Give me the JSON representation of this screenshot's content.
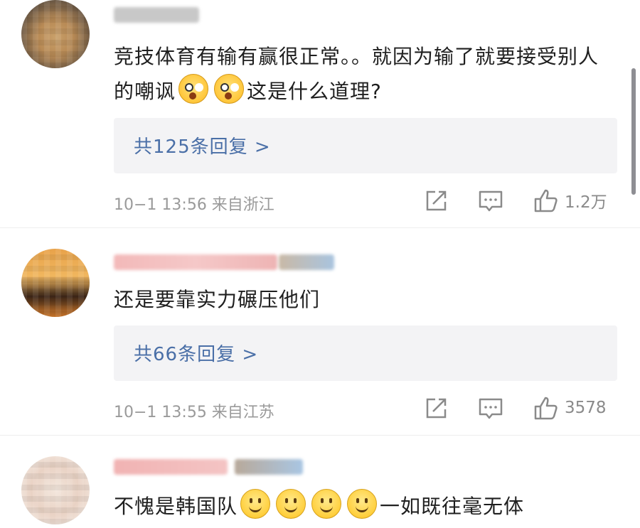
{
  "comments": [
    {
      "username": "",
      "text_part1": "竞技体育有输有赢很正常。。就因为输了就要接受别人的嘲讽",
      "text_part2": "这是什么道理?",
      "emojis": [
        "shocked-face-emoji",
        "shocked-face-emoji"
      ],
      "replies_label": "共125条回复 >",
      "meta": "10−1 13:56 来自浙江",
      "likes": "1.2万"
    },
    {
      "username": "",
      "text": "还是要靠实力碾压他们",
      "replies_label": "共66条回复 >",
      "meta": "10−1 13:55 来自江苏",
      "likes": "3578"
    },
    {
      "username": "",
      "text_part1": "不愧是韩国队",
      "emojis": [
        "smile-emoji",
        "smile-emoji",
        "smile-emoji",
        "smile-emoji"
      ],
      "text_part2": "一如既往毫无体"
    }
  ],
  "icons": [
    "share-icon",
    "comment-icon",
    "like-icon"
  ],
  "colors": {
    "reply_link": "#4a6fa7",
    "meta_text": "#9a9a9a",
    "reply_bg": "#f3f3f5"
  }
}
